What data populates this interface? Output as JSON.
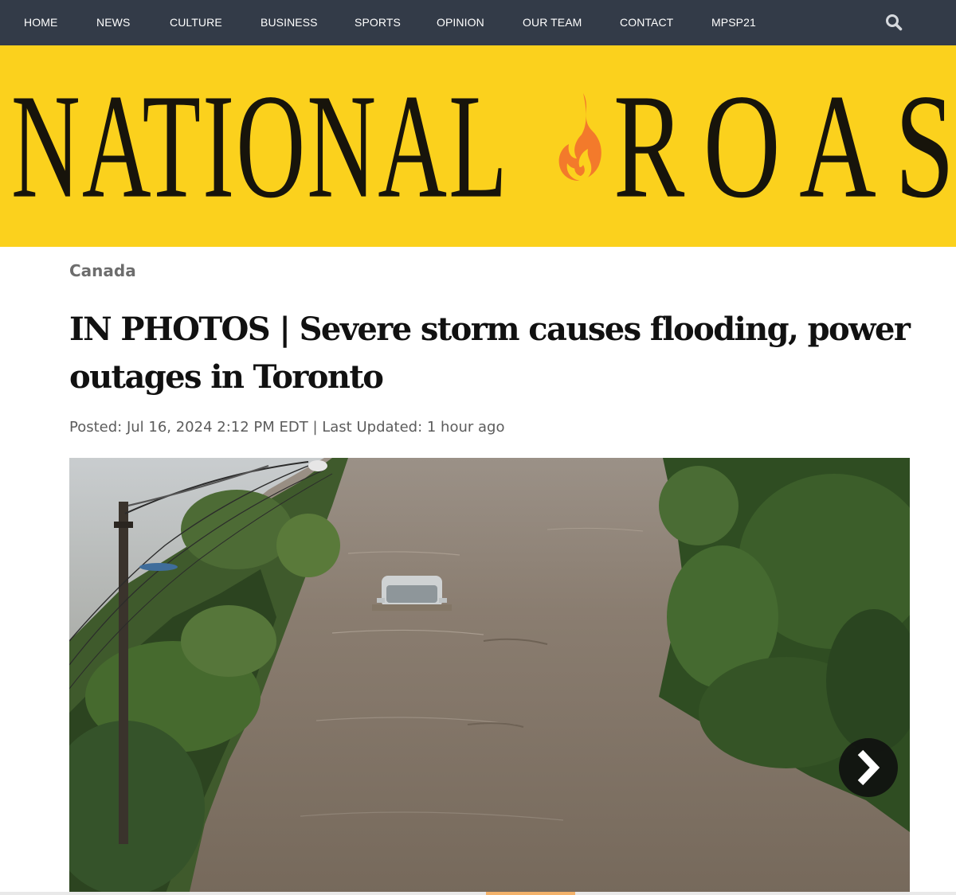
{
  "nav": {
    "items": [
      {
        "label": "HOME"
      },
      {
        "label": "NEWS"
      },
      {
        "label": "CULTURE"
      },
      {
        "label": "BUSINESS"
      },
      {
        "label": "SPORTS"
      },
      {
        "label": "OPINION"
      },
      {
        "label": "OUR TEAM"
      },
      {
        "label": "CONTACT"
      },
      {
        "label": "MPSP21"
      }
    ],
    "search_icon": "search-icon"
  },
  "masthead": {
    "logo_word_1": "NATIONAL",
    "logo_word_2": "ROAST",
    "logo_icon": "flame-icon"
  },
  "article": {
    "category": "Canada",
    "headline": "IN PHOTOS | Severe storm causes flooding, power outages in Toronto",
    "meta": "Posted: Jul 16, 2024 2:12 PM EDT | Last Updated: 1 hour ago"
  },
  "gallery": {
    "next_icon": "chevron-right-icon"
  },
  "colors": {
    "nav_background": "#333b48",
    "masthead_background": "#fbd11d",
    "logo_text": "#17140b",
    "flame": "#f37a2b"
  }
}
